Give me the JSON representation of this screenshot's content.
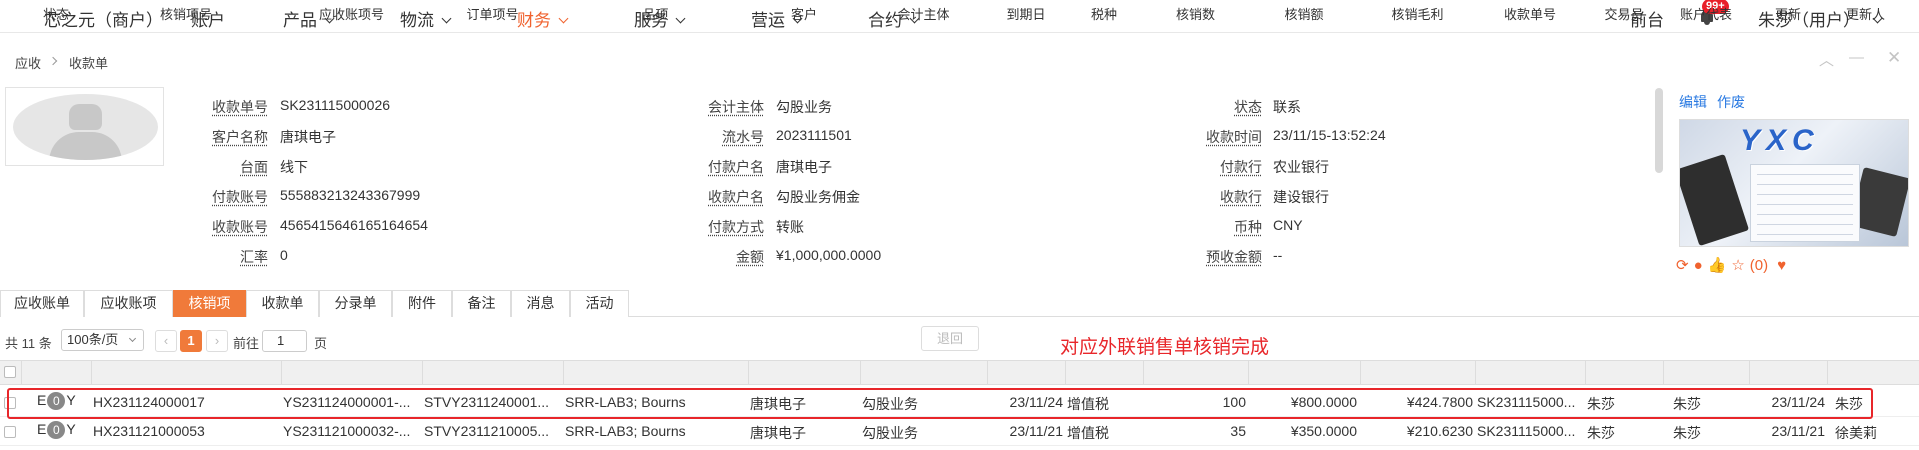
{
  "nav": {
    "brand": "芯之元（商户）",
    "items": [
      {
        "label": "账户",
        "chevron": false,
        "active": false
      },
      {
        "label": "产品",
        "chevron": true,
        "active": false
      },
      {
        "label": "物流",
        "chevron": true,
        "active": false
      },
      {
        "label": "财务",
        "chevron": true,
        "active": true
      },
      {
        "label": "服务",
        "chevron": true,
        "active": false
      },
      {
        "label": "营运",
        "chevron": true,
        "active": false
      },
      {
        "label": "合约",
        "chevron": true,
        "active": false
      }
    ],
    "front_desk": "前台",
    "notification_count": "99+",
    "user": "朱莎（用户）",
    "accent_color": "#f0622e"
  },
  "breadcrumb": {
    "first": "应收",
    "second": "收款单"
  },
  "form": {
    "col1": [
      {
        "label": "收款单号",
        "value": "SK231115000026"
      },
      {
        "label": "客户名称",
        "value": "唐琪电子"
      },
      {
        "label": "台面",
        "value": "线下"
      },
      {
        "label": "付款账号",
        "value": "555883213243367999"
      },
      {
        "label": "收款账号",
        "value": "4565415646165164654"
      },
      {
        "label": "汇率",
        "value": "0"
      }
    ],
    "col2": [
      {
        "label": "会计主体",
        "value": "勾股业务"
      },
      {
        "label": "流水号",
        "value": "2023111501"
      },
      {
        "label": "付款户名",
        "value": "唐琪电子"
      },
      {
        "label": "收款户名",
        "value": "勾股业务佣金"
      },
      {
        "label": "付款方式",
        "value": "转账"
      },
      {
        "label": "金额",
        "value": "¥1,000,000.0000"
      }
    ],
    "col3": [
      {
        "label": "状态",
        "value": "联系"
      },
      {
        "label": "收款时间",
        "value": "23/11/15-13:52:24"
      },
      {
        "label": "付款行",
        "value": "农业银行"
      },
      {
        "label": "收款行",
        "value": "建设银行"
      },
      {
        "label": "币种",
        "value": "CNY"
      },
      {
        "label": "预收金额",
        "value": "--"
      }
    ]
  },
  "right_panel": {
    "edit": "编辑",
    "void": "作废",
    "thumb_logo": "YXC",
    "favorite_count": "(0)"
  },
  "tabs": [
    {
      "label": "应收账单",
      "active": false
    },
    {
      "label": "应收账项",
      "active": false
    },
    {
      "label": "核销项",
      "active": true
    },
    {
      "label": "收款单",
      "active": false
    },
    {
      "label": "分录单",
      "active": false
    },
    {
      "label": "附件",
      "active": false
    },
    {
      "label": "备注",
      "active": false
    },
    {
      "label": "消息",
      "active": false
    },
    {
      "label": "活动",
      "active": false
    }
  ],
  "pager": {
    "total": "共 11 条",
    "page_size": "100条/页",
    "current_page": "1",
    "goto_label": "前往",
    "goto_value": "1",
    "page_suffix": "页",
    "back_button": "退回"
  },
  "annotation": "对应外联销售单核销完成",
  "table": {
    "headers": [
      "状态",
      "核销项号",
      "应收账项号",
      "订单项号",
      "品项",
      "客户",
      "会计主体",
      "到期日",
      "税种",
      "核销数",
      "核销额",
      "核销毛利",
      "收款单号",
      "交易员",
      "账户代表",
      "更新",
      "更新人"
    ],
    "rows": [
      {
        "status_prefix": "E",
        "status_badge": "0",
        "status_suffix": "Y",
        "cells": [
          "HX231124000017",
          "YS231124000001-...",
          "STVY2311240001...",
          "SRR-LAB3; Bourns",
          "唐琪电子",
          "勾股业务",
          "23/11/24",
          "增值税",
          "100",
          "¥800.0000",
          "¥424.7800",
          "SK231115000...",
          "朱莎",
          "朱莎",
          "23/11/24",
          "朱莎"
        ]
      },
      {
        "status_prefix": "E",
        "status_badge": "0",
        "status_suffix": "Y",
        "cells": [
          "HX231121000053",
          "YS231121000032-...",
          "STVY2311210005...",
          "SRR-LAB3; Bourns",
          "唐琪电子",
          "勾股业务",
          "23/11/21",
          "增值税",
          "35",
          "¥350.0000",
          "¥210.6230",
          "SK231115000...",
          "朱莎",
          "朱莎",
          "23/11/21",
          "徐美莉"
        ]
      }
    ]
  }
}
